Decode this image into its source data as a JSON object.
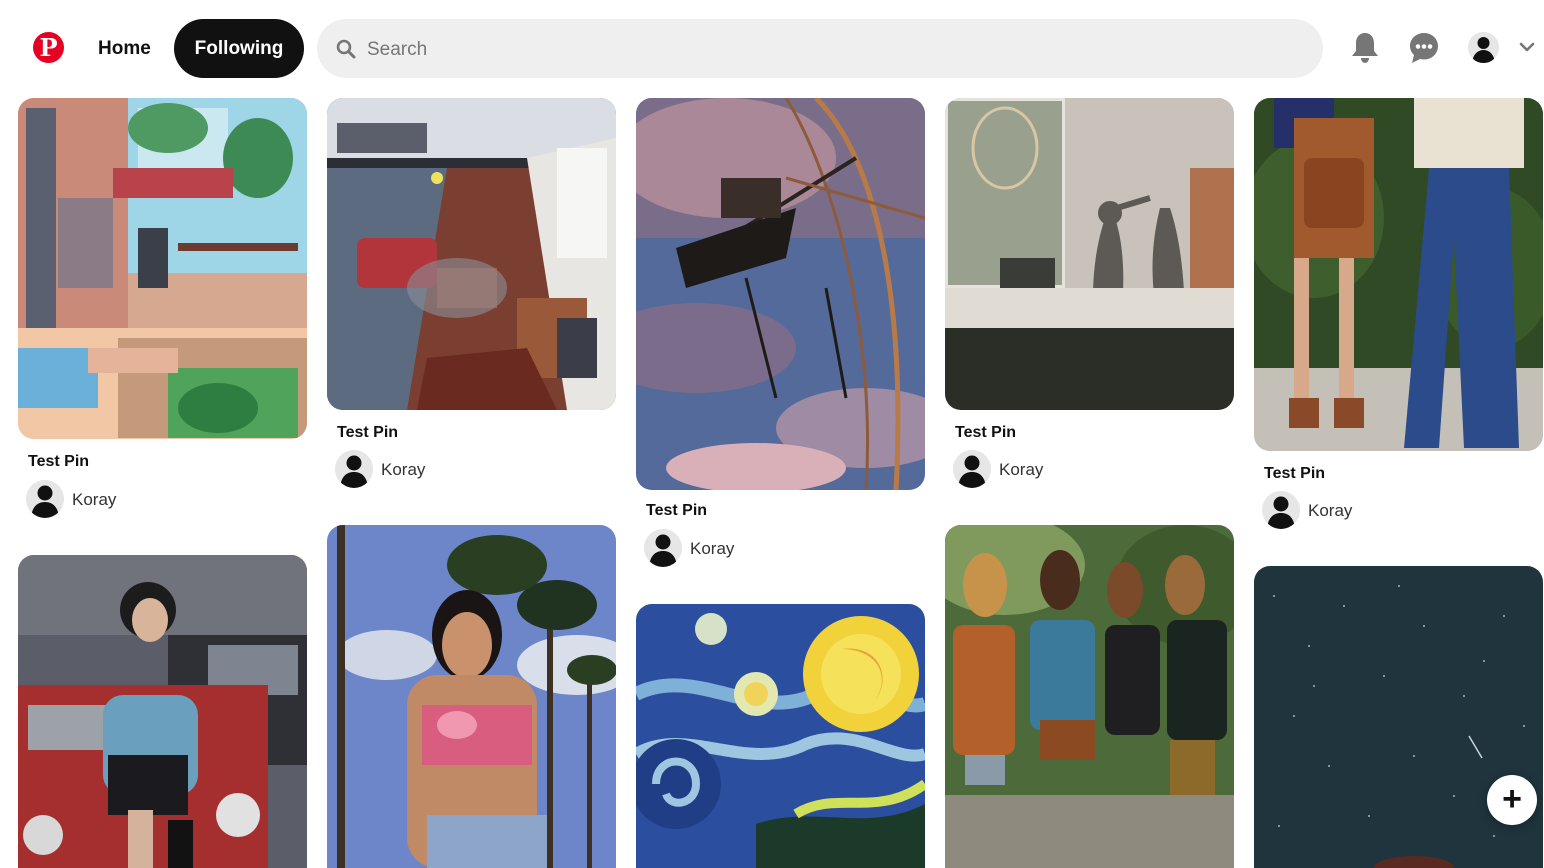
{
  "header": {
    "logo": {
      "icon": "pinterest-logo",
      "glyph": "P",
      "color": "#e60023"
    },
    "nav": {
      "home_label": "Home",
      "following_label": "Following"
    },
    "search": {
      "placeholder": "Search",
      "value": ""
    },
    "icons": [
      "bell-icon",
      "chat-icon",
      "avatar",
      "chevron-down-icon"
    ]
  },
  "pins": [
    {
      "id": "pin1",
      "title": "Test Pin",
      "user": "Koray",
      "image": "anime-room"
    },
    {
      "id": "pin2",
      "title": "Test Pin",
      "user": "Koray",
      "image": "loft-illustration"
    },
    {
      "id": "pin3",
      "title": "Test Pin",
      "user": "Koray",
      "image": "ferris-wheel-sky"
    },
    {
      "id": "pin4",
      "title": "Test Pin",
      "user": "Koray",
      "image": "shadows-wall"
    },
    {
      "id": "pin5",
      "title": "Test Pin",
      "user": "Koray",
      "image": "flared-jeans"
    },
    {
      "id": "pin6",
      "image": "woman-red-car"
    },
    {
      "id": "pin7",
      "image": "palm-trees-portrait"
    },
    {
      "id": "pin8",
      "image": "starry-night"
    },
    {
      "id": "pin9",
      "image": "four-women"
    },
    {
      "id": "pin10",
      "image": "night-sky-stars"
    }
  ],
  "fab": {
    "icon": "plus-icon",
    "glyph": "+"
  }
}
